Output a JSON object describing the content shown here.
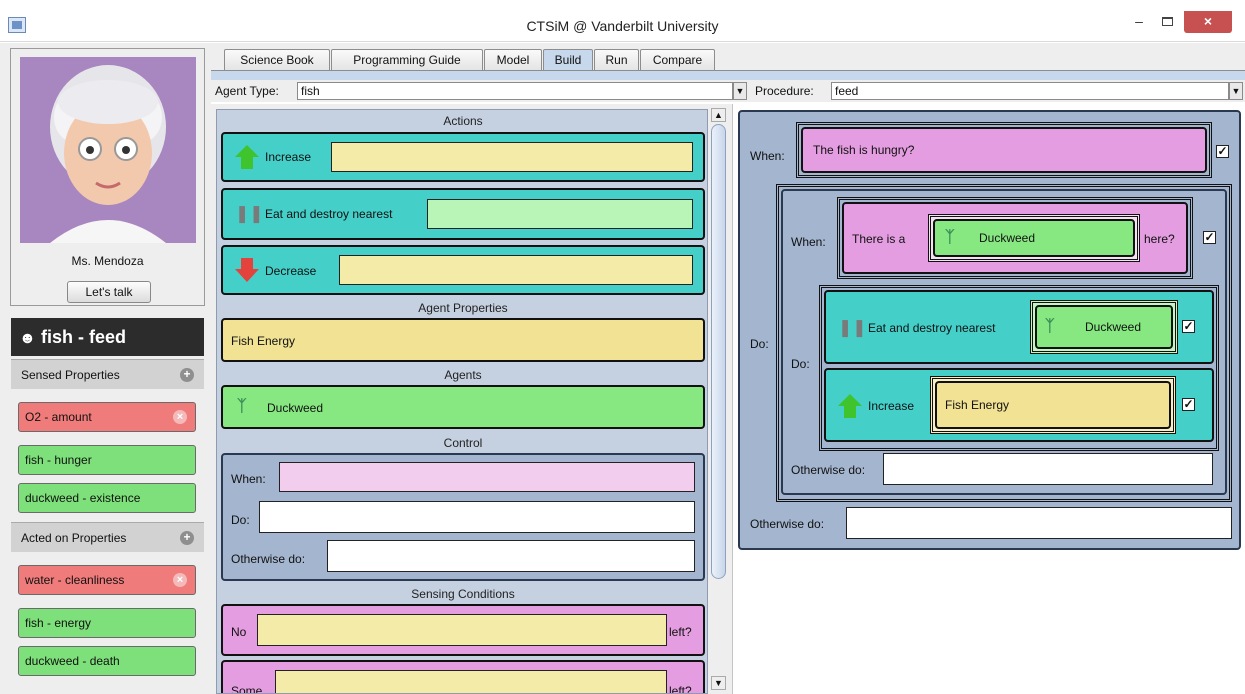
{
  "window": {
    "title": "CTSiM @ Vanderbilt University",
    "min": "–",
    "close": "×"
  },
  "teacher": {
    "name": "Ms. Mendoza",
    "talk_label": "Let's talk"
  },
  "agent_header": {
    "title": "fish - feed"
  },
  "sensed": {
    "label": "Sensed Properties",
    "items": [
      "O2 - amount",
      "fish - hunger",
      "duckweed - existence"
    ]
  },
  "acted": {
    "label": "Acted on Properties",
    "items": [
      "water - cleanliness",
      "fish - energy",
      "duckweed - death"
    ]
  },
  "tabs": [
    "Science Book",
    "Programming Guide",
    "Model",
    "Build",
    "Run",
    "Compare"
  ],
  "active_tab": "Build",
  "agent_type": {
    "label": "Agent Type:",
    "value": "fish"
  },
  "procedure": {
    "label": "Procedure:",
    "value": "feed"
  },
  "palette": {
    "actions_head": "Actions",
    "increase": "Increase",
    "eat": "Eat and destroy nearest",
    "decrease": "Decrease",
    "props_head": "Agent Properties",
    "fish_energy": "Fish Energy",
    "agents_head": "Agents",
    "duckweed": "Duckweed",
    "control_head": "Control",
    "when": "When:",
    "do": "Do:",
    "otherwise": "Otherwise do:",
    "sensing_head": "Sensing Conditions",
    "no": "No",
    "some": "Some",
    "left": "left?"
  },
  "program": {
    "when": "When:",
    "condition": "The fish is hungry?",
    "do": "Do:",
    "inner_when": "When:",
    "there_is_a": "There is a",
    "duckweed": "Duckweed",
    "here": "here?",
    "inner_do": "Do:",
    "eat": "Eat and destroy nearest",
    "duckweed2": "Duckweed",
    "increase": "Increase",
    "fish_energy": "Fish Energy",
    "otherwise_inner": "Otherwise do:",
    "otherwise_outer": "Otherwise do:",
    "check": "✓"
  }
}
